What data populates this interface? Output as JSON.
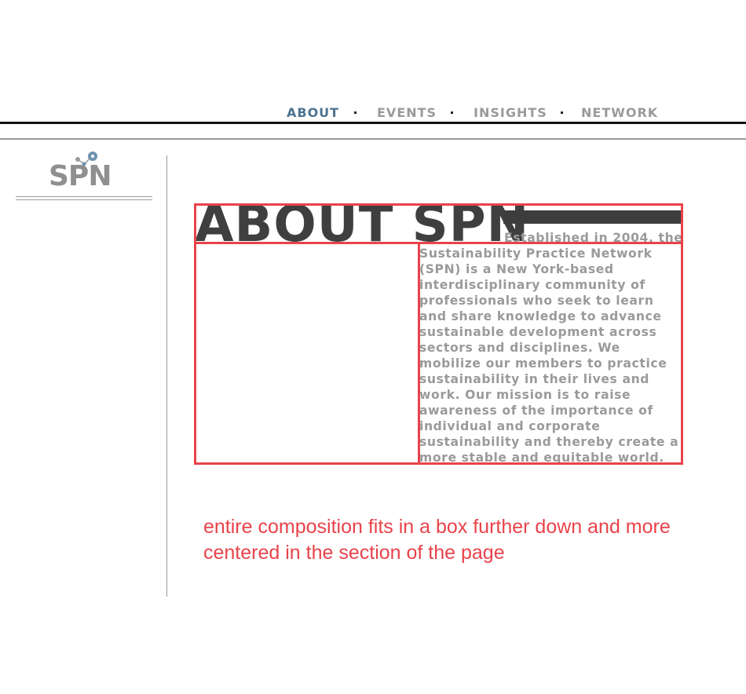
{
  "nav": {
    "items": [
      {
        "label": "ABOUT",
        "active": true
      },
      {
        "label": "EVENTS",
        "active": false
      },
      {
        "label": "INSIGHTS",
        "active": false
      },
      {
        "label": "NETWORK",
        "active": false
      }
    ]
  },
  "logo": {
    "text": "SPN"
  },
  "about": {
    "title": "ABOUT SPN",
    "body": "Established in 2004, the Sustainability Practice Network (SPN) is a New York-based interdisciplinary community of professionals who seek to learn and share knowledge to advance sustainable development across sectors and disciplines. We mobilize our members to practice sustainability in their lives and work. Our mission is to raise awareness of the importance of individual and corporate sustainability and thereby create a more stable and equitable world."
  },
  "annotation": {
    "note": "entire composition fits in a box further down and more centered in the section of the page"
  },
  "colors": {
    "nav_active": "#4d7390",
    "nav_inactive": "#9a9a9a",
    "title": "#3f3f40",
    "body_text": "#9a9a9a",
    "markup_red": "#e8434a"
  }
}
